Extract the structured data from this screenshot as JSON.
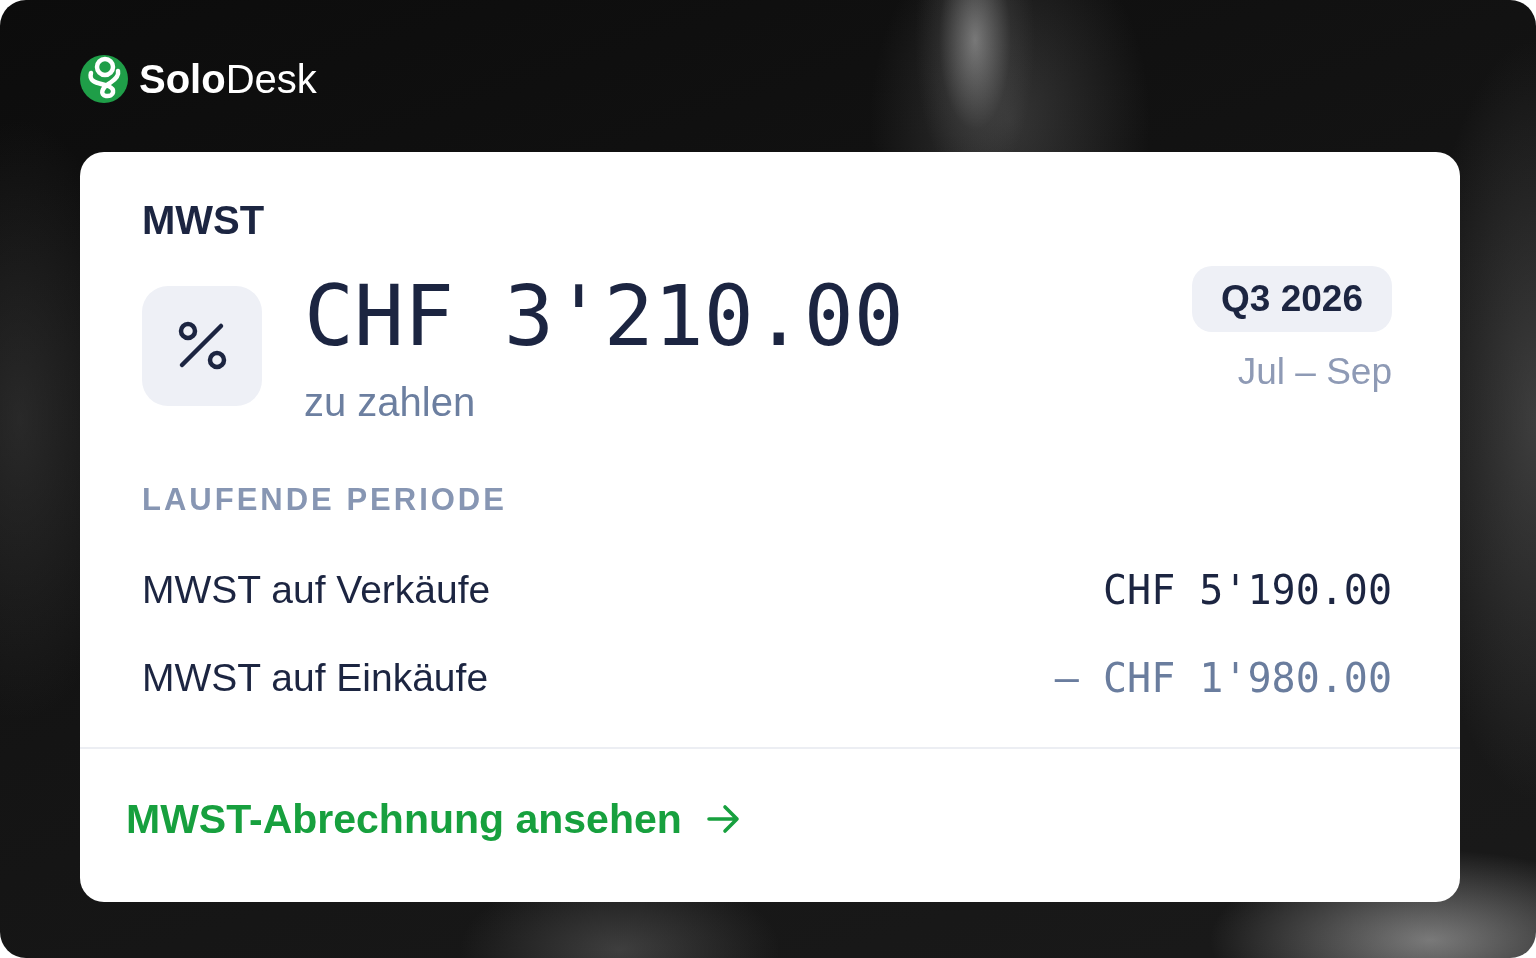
{
  "brand": {
    "name": "**Solo**Desk"
  },
  "card": {
    "title": "MWST",
    "amount": "CHF 3'210.00",
    "amount_caption": "zu zahlen",
    "period": {
      "badge": "Q3 2026",
      "range": "Jul – Sep"
    },
    "section_label": "LAUFENDE PERIODE",
    "rows": [
      {
        "label": "MWST auf Verkäufe",
        "value": "CHF 5'190.00",
        "kind": "credit"
      },
      {
        "label": "MWST auf Einkäufe",
        "value": "– CHF 1'980.00",
        "kind": "deduction"
      }
    ],
    "link": {
      "label": "MWST-Abrechnung ansehen"
    }
  }
}
